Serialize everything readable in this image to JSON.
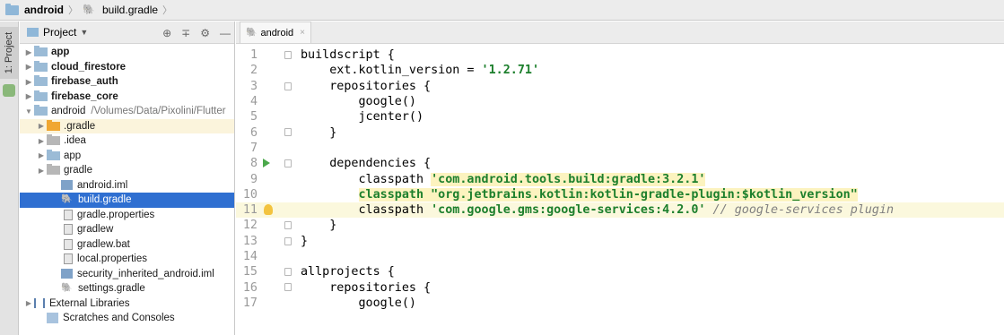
{
  "breadcrumb": {
    "items": [
      {
        "label": "android",
        "icon": "folder-icon"
      },
      {
        "label": "build.gradle",
        "icon": "gradle-icon"
      }
    ]
  },
  "stripe": {
    "project_tab": "1: Project"
  },
  "project_pane": {
    "view_selector": "Project",
    "tree": [
      {
        "label": "app",
        "depth": 0,
        "expand": "collapsed",
        "icon": "module-folder-icon",
        "bold": true
      },
      {
        "label": "cloud_firestore",
        "depth": 0,
        "expand": "collapsed",
        "icon": "module-folder-icon",
        "bold": true
      },
      {
        "label": "firebase_auth",
        "depth": 0,
        "expand": "collapsed",
        "icon": "module-folder-icon",
        "bold": true
      },
      {
        "label": "firebase_core",
        "depth": 0,
        "expand": "collapsed",
        "icon": "module-folder-icon",
        "bold": true
      },
      {
        "label": "android",
        "path": "/Volumes/Data/Pixolini/Flutter",
        "depth": 0,
        "expand": "expanded",
        "icon": "module-folder-icon"
      },
      {
        "label": ".gradle",
        "depth": 1,
        "expand": "collapsed",
        "icon": "folder-orange-icon",
        "highlight": true
      },
      {
        "label": ".idea",
        "depth": 1,
        "expand": "collapsed",
        "icon": "folder-gray-icon"
      },
      {
        "label": "app",
        "depth": 1,
        "expand": "collapsed",
        "icon": "module-folder-icon"
      },
      {
        "label": "gradle",
        "depth": 1,
        "expand": "collapsed",
        "icon": "folder-gray-icon"
      },
      {
        "label": "android.iml",
        "depth": 2,
        "icon": "iml-file-icon"
      },
      {
        "label": "build.gradle",
        "depth": 2,
        "icon": "gradle-icon",
        "selected": true
      },
      {
        "label": "gradle.properties",
        "depth": 2,
        "icon": "properties-file-icon"
      },
      {
        "label": "gradlew",
        "depth": 2,
        "icon": "file-icon"
      },
      {
        "label": "gradlew.bat",
        "depth": 2,
        "icon": "file-icon"
      },
      {
        "label": "local.properties",
        "depth": 2,
        "icon": "properties-file-icon"
      },
      {
        "label": "security_inherited_android.iml",
        "depth": 2,
        "icon": "iml-file-icon"
      },
      {
        "label": "settings.gradle",
        "depth": 2,
        "icon": "gradle-icon"
      },
      {
        "label": "External Libraries",
        "depth": 0,
        "expand": "collapsed",
        "icon": "libraries-icon"
      },
      {
        "label": "Scratches and Consoles",
        "depth": 1,
        "icon": "scratches-icon"
      }
    ]
  },
  "editor": {
    "tab": {
      "label": "android",
      "icon": "gradle-icon"
    },
    "current_line": 11,
    "lines": [
      {
        "n": "1",
        "parts": [
          {
            "t": "buildscript {",
            "c": "kw"
          }
        ],
        "fold": true
      },
      {
        "n": "2",
        "parts": [
          {
            "t": "    ext.kotlin_version = ",
            "c": "kw"
          },
          {
            "t": "'1.2.71'",
            "c": "str"
          }
        ]
      },
      {
        "n": "3",
        "parts": [
          {
            "t": "    repositories {",
            "c": "kw"
          }
        ],
        "fold": true
      },
      {
        "n": "4",
        "parts": [
          {
            "t": "        google()",
            "c": "kw"
          }
        ]
      },
      {
        "n": "5",
        "parts": [
          {
            "t": "        jcenter()",
            "c": "kw"
          }
        ]
      },
      {
        "n": "6",
        "parts": [
          {
            "t": "    }",
            "c": "kw"
          }
        ],
        "fold": true
      },
      {
        "n": "7",
        "parts": [
          {
            "t": "",
            "c": "kw"
          }
        ]
      },
      {
        "n": "8",
        "parts": [
          {
            "t": "    dependencies {",
            "c": "kw"
          }
        ],
        "fold": true,
        "gutter": "run"
      },
      {
        "n": "9",
        "parts": [
          {
            "t": "        classpath ",
            "c": "kw"
          },
          {
            "t": "'com.android.tools.build:gradle:3.2.1'",
            "c": "str hl"
          }
        ]
      },
      {
        "n": "10",
        "parts": [
          {
            "t": "        ",
            "c": "kw"
          },
          {
            "t": "classpath \"org.jetbrains.kotlin:kotlin-gradle-plugin:$kotlin_version\"",
            "c": "str hl"
          }
        ]
      },
      {
        "n": "11",
        "parts": [
          {
            "t": "        classpath ",
            "c": "kw"
          },
          {
            "t": "'com.google.gms:google-services:4.2.0'",
            "c": "str"
          },
          {
            "t": " // google-services plugin",
            "c": "cmt"
          }
        ],
        "gutter": "bulb"
      },
      {
        "n": "12",
        "parts": [
          {
            "t": "    }",
            "c": "kw"
          }
        ],
        "fold": true
      },
      {
        "n": "13",
        "parts": [
          {
            "t": "}",
            "c": "kw"
          }
        ],
        "fold": true
      },
      {
        "n": "14",
        "parts": [
          {
            "t": "",
            "c": "kw"
          }
        ]
      },
      {
        "n": "15",
        "parts": [
          {
            "t": "allprojects {",
            "c": "kw"
          }
        ],
        "fold": true
      },
      {
        "n": "16",
        "parts": [
          {
            "t": "    repositories {",
            "c": "kw"
          }
        ],
        "fold": true
      },
      {
        "n": "17",
        "parts": [
          {
            "t": "        google()",
            "c": "kw"
          }
        ]
      }
    ]
  }
}
